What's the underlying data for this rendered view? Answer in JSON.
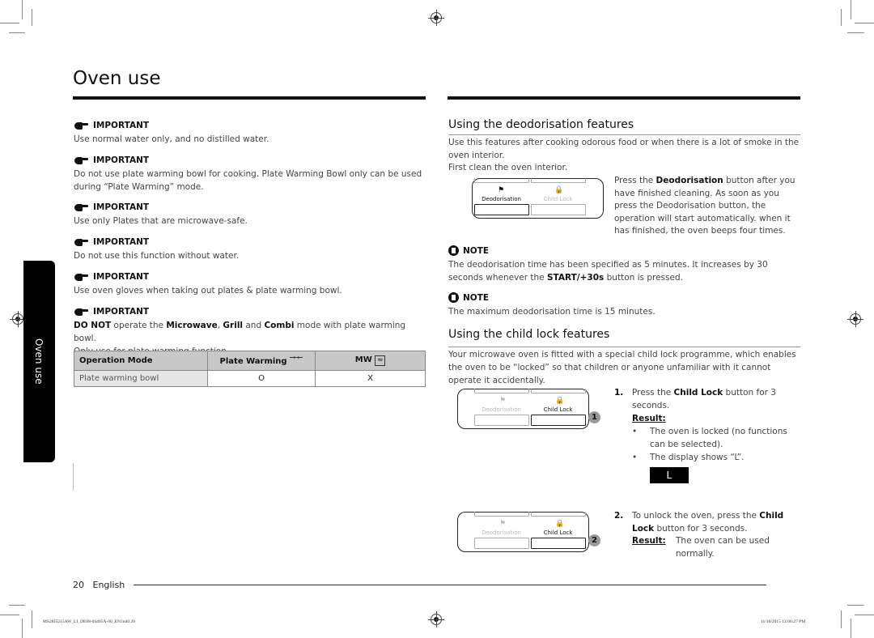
{
  "page": {
    "title": "Oven use",
    "side_tab": "Oven use",
    "page_number": "20",
    "language": "English",
    "slug_left": "MS28J5215AW_LI_DE68-04405A-00_EN.indd   20",
    "slug_right": "11/16/2015   12:06:27 PM"
  },
  "left_column": {
    "important_label": "IMPORTANT",
    "important_items": [
      {
        "text": "Use normal water only, and no distilled water."
      },
      {
        "text": "Do not use plate warming bowl for cooking. Plate Warming Bowl only can be used during “Plate Warming” mode."
      },
      {
        "text": "Use only Plates that are microwave-safe."
      },
      {
        "text": "Do not use this function without water."
      },
      {
        "text": "Use oven gloves when taking out plates & plate warming bowl."
      }
    ],
    "last_important": {
      "bold1": "DO NOT",
      "t1": " operate the ",
      "bold2": "Microwave",
      "t2": ", ",
      "bold3": "Grill",
      "t3": " and ",
      "bold4": "Combi",
      "t4": " mode with plate warming bowl.",
      "line2": "Only use for plate warming function."
    },
    "table": {
      "headers": [
        "Operation Mode",
        "Plate Warming",
        "MW"
      ],
      "rows": [
        [
          "Plate warming bowl",
          "O",
          "X"
        ]
      ]
    }
  },
  "right_column": {
    "deodorisation": {
      "title": "Using the deodorisation features",
      "intro": "Use this features after cooking odorous food or when there is a lot of smoke in the oven interior.",
      "first_clean": "First clean the oven interior.",
      "press_pre": "Press the ",
      "press_bold": "Deodorisation",
      "press_post": " button after you have finished cleaning. As soon as you press the Deodorisation button, the operation will start automatically. when it has finished, the oven beeps four times.",
      "panel_labels": [
        "Deodorisation",
        "Child Lock"
      ]
    },
    "notes": {
      "label": "NOTE",
      "note1_pre": "The deodorisation time has been specified as 5 minutes. It increases by 30 seconds whenever the ",
      "note1_bold": "START/+30s",
      "note1_post": " button is pressed.",
      "note2": "The maximum deodorisation time is 15 minutes."
    },
    "child_lock": {
      "title": "Using the child lock features",
      "intro": "Your microwave oven is fitted with a special child lock programme, which enables the oven to be “locked” so that children or anyone unfamiliar with it cannot operate it accidentally.",
      "step1": {
        "num": "1.",
        "pre": "Press the ",
        "bold": "Child Lock",
        "post": " button for 3 seconds.",
        "result_label": "Result:",
        "bullets": [
          "The oven is locked (no functions can be selected).",
          "The display shows “L”."
        ],
        "display": "L",
        "badge": "1"
      },
      "step2": {
        "num": "2.",
        "pre": "To unlock the oven, press the ",
        "bold": "Child Lock",
        "post": " button for 3 seconds.",
        "result_label": "Result:",
        "result_text": "The oven can be used normally.",
        "badge": "2"
      }
    }
  }
}
